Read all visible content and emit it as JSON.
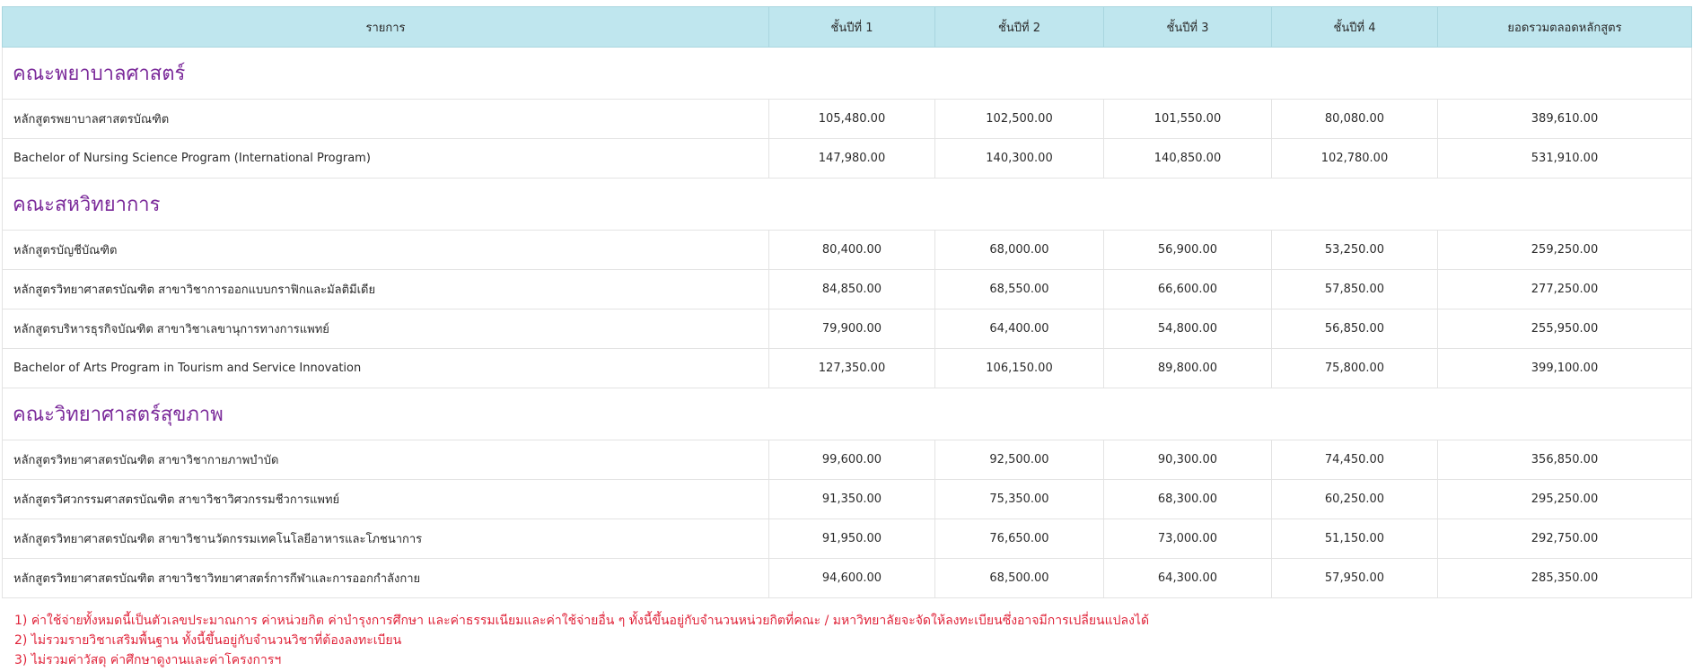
{
  "header": {
    "item": "รายการ",
    "year1": "ชั้นปีที่ 1",
    "year2": "ชั้นปีที่ 2",
    "year3": "ชั้นปีที่ 3",
    "year4": "ชั้นปีที่ 4",
    "total": "ยอดรวมตลอดหลักสูตร"
  },
  "faculties": [
    {
      "name": "คณะพยาบาลศาสตร์",
      "programs": [
        {
          "name": "หลักสูตรพยาบาลศาสตรบัณฑิต",
          "y1": "105,480.00",
          "y2": "102,500.00",
          "y3": "101,550.00",
          "y4": "80,080.00",
          "total": "389,610.00"
        },
        {
          "name": "Bachelor of Nursing Science Program (International Program)",
          "y1": "147,980.00",
          "y2": "140,300.00",
          "y3": "140,850.00",
          "y4": "102,780.00",
          "total": "531,910.00"
        }
      ]
    },
    {
      "name": "คณะสหวิทยาการ",
      "programs": [
        {
          "name": "หลักสูตรบัญชีบัณฑิต",
          "y1": "80,400.00",
          "y2": "68,000.00",
          "y3": "56,900.00",
          "y4": "53,250.00",
          "total": "259,250.00"
        },
        {
          "name": "หลักสูตรวิทยาศาสตรบัณฑิต สาขาวิชาการออกแบบกราฟิกและมัลติมีเดีย",
          "y1": "84,850.00",
          "y2": "68,550.00",
          "y3": "66,600.00",
          "y4": "57,850.00",
          "total": "277,250.00"
        },
        {
          "name": "หลักสูตรบริหารธุรกิจบัณฑิต สาขาวิชาเลขานุการทางการแพทย์",
          "y1": "79,900.00",
          "y2": "64,400.00",
          "y3": "54,800.00",
          "y4": "56,850.00",
          "total": "255,950.00"
        },
        {
          "name": "Bachelor of Arts Program in Tourism and Service Innovation",
          "y1": "127,350.00",
          "y2": "106,150.00",
          "y3": "89,800.00",
          "y4": "75,800.00",
          "total": "399,100.00"
        }
      ]
    },
    {
      "name": "คณะวิทยาศาสตร์สุขภาพ",
      "programs": [
        {
          "name": "หลักสูตรวิทยาศาสตรบัณฑิต สาขาวิชากายภาพบำบัด",
          "y1": "99,600.00",
          "y2": "92,500.00",
          "y3": "90,300.00",
          "y4": "74,450.00",
          "total": "356,850.00"
        },
        {
          "name": "หลักสูตรวิศวกรรมศาสตรบัณฑิต สาขาวิชาวิศวกรรมชีวการแพทย์",
          "y1": "91,350.00",
          "y2": "75,350.00",
          "y3": "68,300.00",
          "y4": "60,250.00",
          "total": "295,250.00"
        },
        {
          "name": "หลักสูตรวิทยาศาสตรบัณฑิต สาขาวิชานวัตกรรมเทคโนโลยีอาหารและโภชนาการ",
          "y1": "91,950.00",
          "y2": "76,650.00",
          "y3": "73,000.00",
          "y4": "51,150.00",
          "total": "292,750.00"
        },
        {
          "name": "หลักสูตรวิทยาศาสตรบัณฑิต สาขาวิชาวิทยาศาสตร์การกีฬาและการออกกำลังกาย",
          "y1": "94,600.00",
          "y2": "68,500.00",
          "y3": "64,300.00",
          "y4": "57,950.00",
          "total": "285,350.00"
        }
      ]
    }
  ],
  "notes": [
    "1) ค่าใช้จ่ายทั้งหมดนี้เป็นตัวเลขประมาณการ ค่าหน่วยกิต ค่าบำรุงการศึกษา และค่าธรรมเนียมและค่าใช้จ่ายอื่น ๆ ทั้งนี้ขึ้นอยู่กับจำนวนหน่วยกิตที่คณะ / มหาวิทยาลัยจะจัดให้ลงทะเบียนซึ่งอาจมีการเปลี่ยนแปลงได้",
    "2) ไม่รวมรายวิชาเสริมพื้นฐาน ทั้งนี้ขึ้นอยู่กับจำนวนวิชาที่ต้องลงทะเบียน",
    "3) ไม่รวมค่าวัสดุ ค่าศึกษาดูงานและค่าโครงการฯ"
  ]
}
